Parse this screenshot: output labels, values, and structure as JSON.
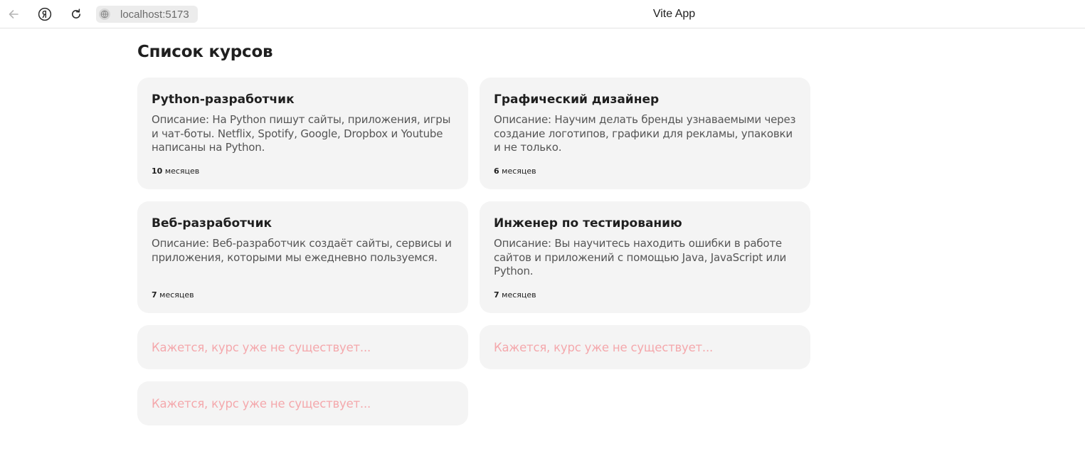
{
  "browser": {
    "url": "localhost:5173",
    "tab_title": "Vite App",
    "icons": {
      "back": "arrow-left-icon",
      "yandex": "yandex-logo-icon",
      "reload": "reload-icon",
      "site": "globe-icon"
    }
  },
  "page": {
    "heading": "Список курсов",
    "courses": [
      {
        "title": "Python-разработчик",
        "description": "Описание: На Python пишут сайты, приложения, игры и чат-боты. Netflix, Spotify, Google, Dropbox и Youtube написаны на Python.",
        "duration_number": "10",
        "duration_unit": "месяцев"
      },
      {
        "title": "Графический дизайнер",
        "description": "Описание: Научим делать бренды узнаваемыми через создание логотипов, графики для рекламы, упаковки и не только.",
        "duration_number": "6",
        "duration_unit": "месяцев"
      },
      {
        "title": "Веб-разработчик",
        "description": "Описание: Веб-разработчик создаёт сайты, сервисы и приложения, которыми мы ежедневно пользуемся.",
        "duration_number": "7",
        "duration_unit": "месяцев"
      },
      {
        "title": "Инженер по тестированию",
        "description": "Описание: Вы научитесь находить ошибки в работе сайтов и приложений с помощью Java, JavaScript или Python.",
        "duration_number": "7",
        "duration_unit": "месяцев"
      }
    ],
    "missing_courses": [
      "Кажется, курс уже не существует...",
      "Кажется, курс уже не существует...",
      "Кажется, курс уже не существует..."
    ],
    "colors": {
      "card_background": "#f4f4f4",
      "missing_text": "#f4a8ac"
    }
  }
}
